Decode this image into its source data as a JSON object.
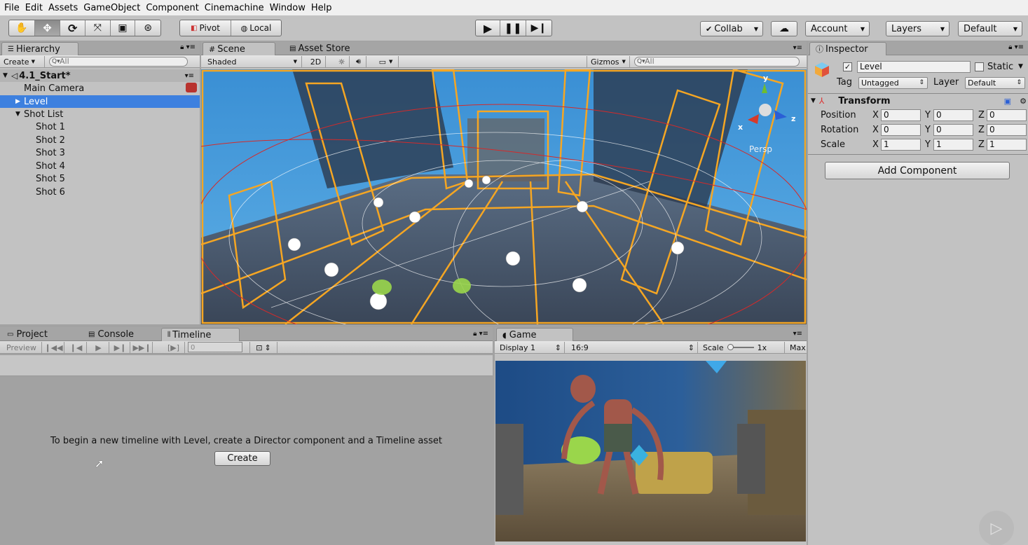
{
  "menu": [
    "File",
    "Edit",
    "Assets",
    "GameObject",
    "Component",
    "Cinemachine",
    "Window",
    "Help"
  ],
  "toolbar": {
    "tools": [
      "hand-tool",
      "move-tool",
      "rotate-tool",
      "scale-tool",
      "rect-tool",
      "transform-tool"
    ],
    "pivot": "Pivot",
    "local": "Local",
    "collab": "Collab",
    "account": "Account",
    "layers": "Layers",
    "layout": "Default"
  },
  "hierarchy": {
    "tab": "Hierarchy",
    "create": "Create",
    "search_placeholder": "All",
    "scene_name": "4.1_Start*",
    "items": {
      "main_camera": "Main Camera",
      "level": "Level",
      "shot_list": "Shot List",
      "shots": [
        "Shot 1",
        "Shot 2",
        "Shot 3",
        "Shot 4",
        "Shot 5",
        "Shot 6"
      ]
    }
  },
  "scene": {
    "tabs": {
      "scene": "Scene",
      "asset_store": "Asset Store"
    },
    "shading": "Shaded",
    "mode_2d": "2D",
    "gizmos": "Gizmos",
    "search_placeholder": "All",
    "persp": "Persp",
    "axis_y": "y",
    "axis_x": "x",
    "axis_z": "z"
  },
  "inspector": {
    "tab": "Inspector",
    "object_name": "Level",
    "static_label": "Static",
    "tag_label": "Tag",
    "tag_value": "Untagged",
    "layer_label": "Layer",
    "layer_value": "Default",
    "transform": "Transform",
    "rows": {
      "position": {
        "label": "Position",
        "x": "0",
        "y": "0",
        "z": "0"
      },
      "rotation": {
        "label": "Rotation",
        "x": "0",
        "y": "0",
        "z": "0"
      },
      "scale": {
        "label": "Scale",
        "x": "1",
        "y": "1",
        "z": "1"
      }
    },
    "axis": {
      "x": "X",
      "y": "Y",
      "z": "Z"
    },
    "add_component": "Add Component"
  },
  "bottom": {
    "tabs": {
      "project": "Project",
      "console": "Console",
      "timeline": "Timeline"
    },
    "preview": "Preview",
    "frame": "0",
    "message": "To begin a new timeline with Level, create a Director component and a Timeline asset",
    "create_button": "Create"
  },
  "game": {
    "tab": "Game",
    "display": "Display 1",
    "aspect": "16:9",
    "scale_label": "Scale",
    "scale_value": "1x",
    "maximize": "Max"
  }
}
